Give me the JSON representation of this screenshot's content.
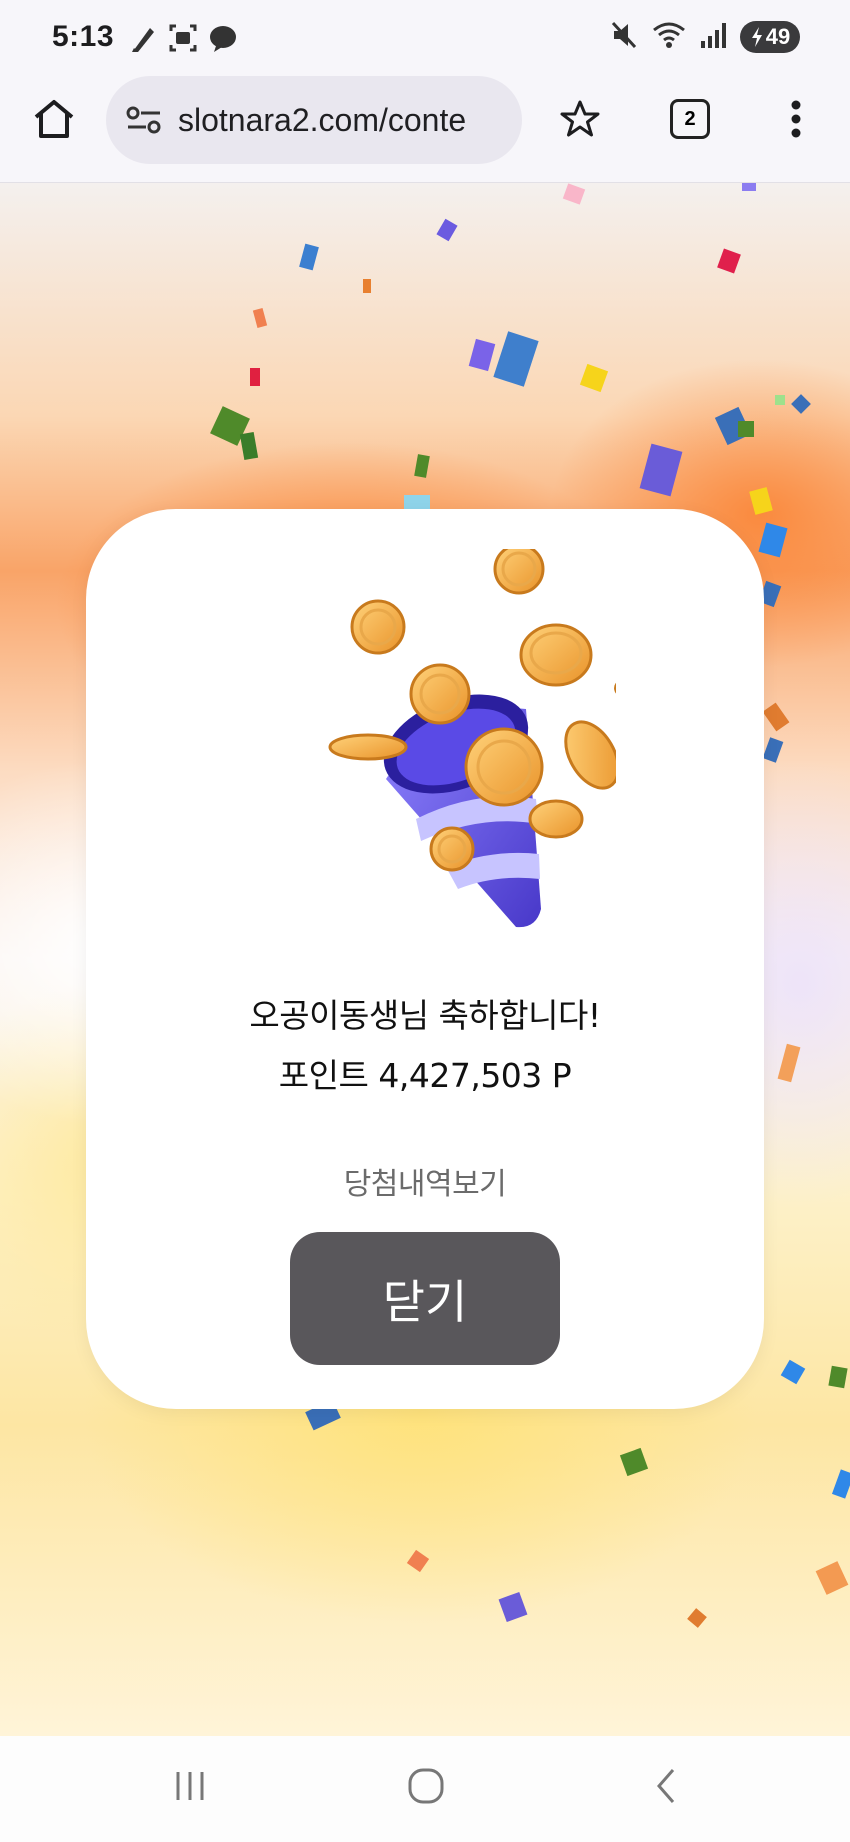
{
  "status_bar": {
    "time": "5:13",
    "battery": "49",
    "left_icons": [
      "notification-pen-icon",
      "screenshot-icon",
      "messenger-icon"
    ],
    "right_icons": [
      "mute-icon",
      "wifi-icon",
      "signal-icon",
      "battery-icon"
    ]
  },
  "browser": {
    "url": "slotnara2.com/conte",
    "tab_count": "2",
    "icons": [
      "home-icon",
      "site-settings-icon",
      "bookmark-star-icon",
      "tab-switcher-icon",
      "more-menu-icon"
    ]
  },
  "modal": {
    "message": "오공이동생님 축하합니다!",
    "points_label": "포인트 4,427,503 P",
    "history_link": "당첨내역보기",
    "close_button": "닫기",
    "illustration": "coin-party-popper-icon"
  },
  "nav_bar": {
    "icons": [
      "recent-apps-icon",
      "home-circle-icon",
      "back-icon"
    ]
  },
  "colors": {
    "button_bg": "#59575b",
    "accent_orange": "#f98a3c",
    "popper_purple": "#6a5cf2",
    "coin_gold": "#f7b548"
  }
}
